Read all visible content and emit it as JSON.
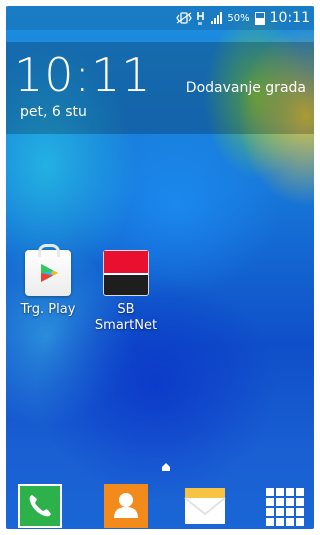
{
  "status_bar": {
    "battery_percent": "50%",
    "time": "10:11",
    "icons": [
      "mute-vibrate-icon",
      "network-h-icon",
      "signal-icon",
      "battery-icon"
    ]
  },
  "clock_widget": {
    "time": "10:11",
    "date": "pet, 6 stu",
    "add_city_label": "Dodavanje grada"
  },
  "apps": [
    {
      "label": "Trg. Play",
      "icon": "play-store-icon"
    },
    {
      "label": "SB SmartNet",
      "icon": "sb-smartnet-icon",
      "accent": "#e8102e"
    }
  ],
  "dock": [
    {
      "icon": "phone-icon",
      "color": "#2db14a"
    },
    {
      "icon": "contacts-icon",
      "color": "#f28a1c"
    },
    {
      "icon": "messages-icon",
      "color": "#f6c343"
    },
    {
      "icon": "apps-grid-icon",
      "color": "#ffffff"
    }
  ]
}
